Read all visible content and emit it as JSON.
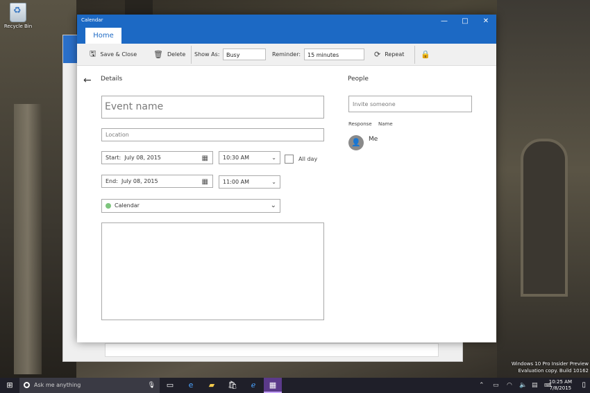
{
  "desktop": {
    "recycle_bin": "Recycle Bin"
  },
  "window": {
    "title": "Calendar",
    "controls": {
      "minimize": "—",
      "maximize": "□",
      "close": "✕"
    },
    "tabs": [
      {
        "label": "Home"
      }
    ]
  },
  "toolbar": {
    "save_close": "Save & Close",
    "delete": "Delete",
    "show_as_label": "Show As:",
    "show_as_value": "Busy",
    "reminder_label": "Reminder:",
    "reminder_value": "15 minutes",
    "repeat": "Repeat",
    "icons": {
      "save": "save-icon",
      "delete": "trash-icon",
      "repeat": "repeat-icon",
      "private": "lock-icon"
    }
  },
  "details": {
    "heading": "Details",
    "event_name_placeholder": "Event name",
    "location_placeholder": "Location",
    "start_label": "Start:",
    "start_date": "July 08, 2015",
    "start_time": "10:30 AM",
    "all_day_label": "All day",
    "end_label": "End:",
    "end_date": "July 08, 2015",
    "end_time": "11:00 AM",
    "calendar": "Calendar",
    "calendar_color": "#7dc57d"
  },
  "people": {
    "heading": "People",
    "invite_placeholder": "Invite someone",
    "col_response": "Response",
    "col_name": "Name",
    "attendees": [
      {
        "name": "Me"
      }
    ]
  },
  "taskbar": {
    "search_placeholder": "Ask me anything",
    "time": "10:25 AM",
    "date": "7/8/2015"
  },
  "watermark": {
    "line1": "Windows 10 Pro Insider Preview",
    "line2": "Evaluation copy. Build 10162"
  },
  "colors": {
    "accent": "#1c69c4",
    "taskbar": "#1f1f29",
    "active_app": "#5b3a8a"
  }
}
